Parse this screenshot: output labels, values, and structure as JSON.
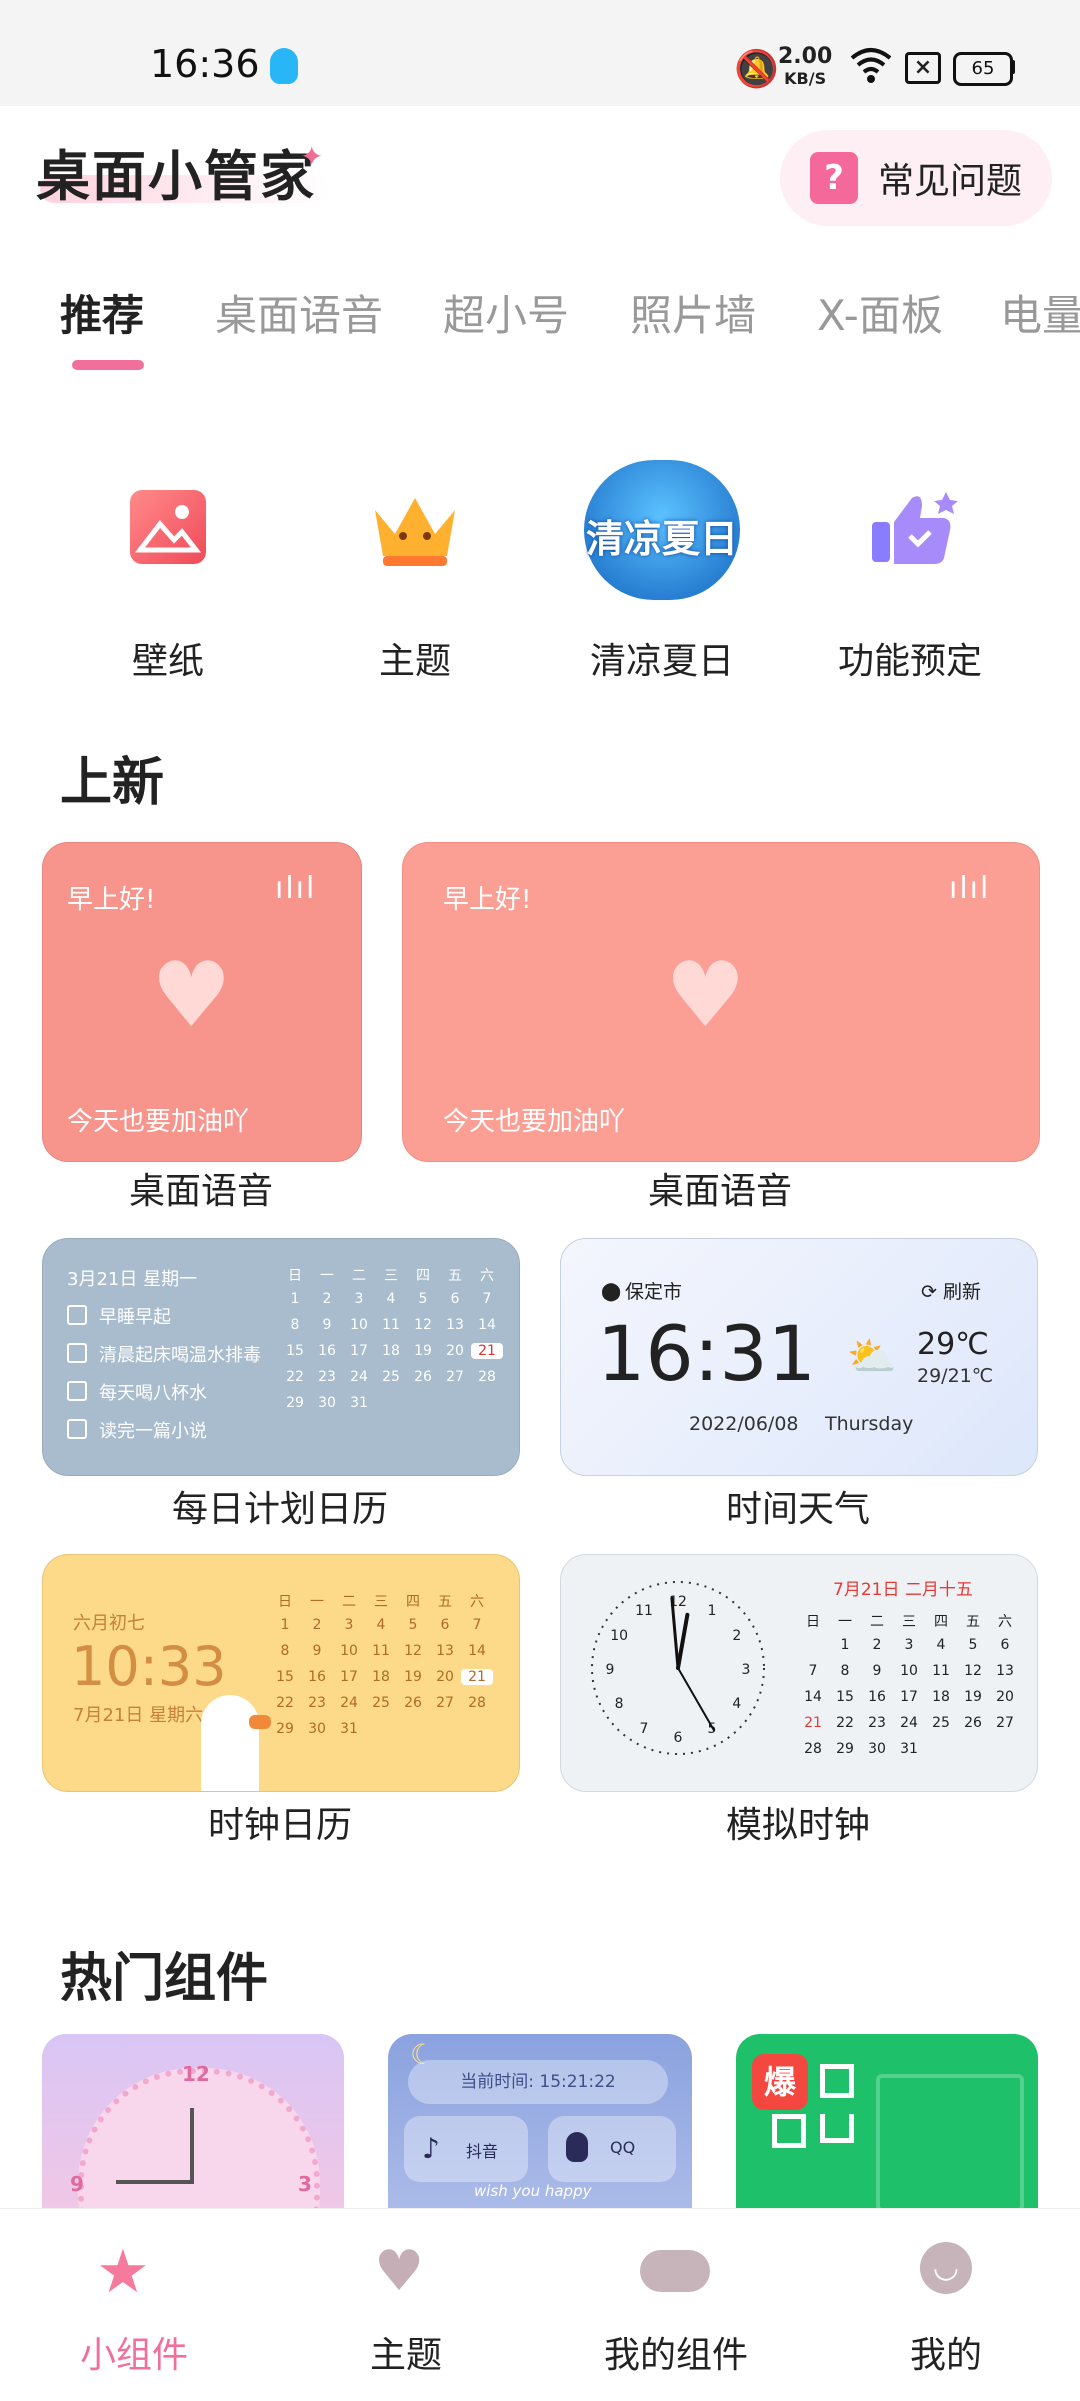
{
  "status": {
    "time": "16:36",
    "speed_value": "2.00",
    "speed_unit": "KB/S",
    "battery": "65"
  },
  "header": {
    "app_title": "桌面小管家",
    "faq_label": "常见问题",
    "faq_icon": "?"
  },
  "tabs": [
    "推荐",
    "桌面语音",
    "超小号",
    "照片墙",
    "X-面板",
    "电量"
  ],
  "quick_entries": [
    {
      "label": "壁纸",
      "icon": "image-icon"
    },
    {
      "label": "主题",
      "icon": "crown-icon"
    },
    {
      "label": "清凉夏日",
      "icon": "summer-badge-icon",
      "badge_text": "清凉夏日"
    },
    {
      "label": "功能预定",
      "icon": "thumbs-up-icon"
    }
  ],
  "sections": {
    "new": "上新",
    "hot": "热门组件"
  },
  "voice_cards": [
    {
      "greeting": "早上好!",
      "message": "今天也要加油吖",
      "caption": "桌面语音"
    },
    {
      "greeting": "早上好!",
      "message": "今天也要加油吖",
      "caption": "桌面语音"
    }
  ],
  "plan_calendar": {
    "caption": "每日计划日历",
    "date": "3月21日 星期一",
    "tasks": [
      "早睡早起",
      "清晨起床喝温水排毒",
      "每天喝八杯水",
      "读完一篇小说"
    ],
    "weekdays": [
      "日",
      "一",
      "二",
      "三",
      "四",
      "五",
      "六"
    ],
    "rows": [
      [
        "1",
        "2",
        "3",
        "4",
        "5",
        "6",
        "7"
      ],
      [
        "8",
        "9",
        "10",
        "11",
        "12",
        "13",
        "14"
      ],
      [
        "15",
        "16",
        "17",
        "18",
        "19",
        "20",
        "21"
      ],
      [
        "22",
        "23",
        "24",
        "25",
        "26",
        "27",
        "28"
      ],
      [
        "29",
        "30",
        "31",
        "",
        "",
        "",
        ""
      ]
    ],
    "highlight": "21"
  },
  "weather": {
    "caption": "时间天气",
    "city": "保定市",
    "refresh": "刷新",
    "time": "16:31",
    "temp": "29℃",
    "range": "29/21℃",
    "date": "2022/06/08",
    "weekday": "Thursday"
  },
  "clock_calendar": {
    "caption": "时钟日历",
    "lunar": "六月初七",
    "time": "10:33",
    "date": "7月21日 星期六",
    "weekdays": [
      "日",
      "一",
      "二",
      "三",
      "四",
      "五",
      "六"
    ],
    "rows": [
      [
        "1",
        "2",
        "3",
        "4",
        "5",
        "6",
        "7"
      ],
      [
        "8",
        "9",
        "10",
        "11",
        "12",
        "13",
        "14"
      ],
      [
        "15",
        "16",
        "17",
        "18",
        "19",
        "20",
        "21"
      ],
      [
        "22",
        "23",
        "24",
        "25",
        "26",
        "27",
        "28"
      ],
      [
        "29",
        "30",
        "31",
        "",
        "",
        "",
        ""
      ]
    ],
    "highlight": "21"
  },
  "analog": {
    "caption": "模拟时钟",
    "header": "7月21日 二月十五",
    "numbers": [
      "12",
      "1",
      "2",
      "3",
      "4",
      "5",
      "6",
      "7",
      "8",
      "9",
      "10",
      "11"
    ],
    "weekdays": [
      "日",
      "一",
      "二",
      "三",
      "四",
      "五",
      "六"
    ],
    "rows": [
      [
        "",
        "1",
        "2",
        "3",
        "4",
        "5",
        "6"
      ],
      [
        "7",
        "8",
        "9",
        "10",
        "11",
        "12",
        "13"
      ],
      [
        "14",
        "15",
        "16",
        "17",
        "18",
        "19",
        "20"
      ],
      [
        "21",
        "22",
        "23",
        "24",
        "25",
        "26",
        "27"
      ],
      [
        "28",
        "29",
        "30",
        "31",
        "",
        "",
        ""
      ]
    ],
    "highlight": "21"
  },
  "hot_items": [
    {
      "clock_numbers": [
        "12",
        "3",
        "9"
      ]
    },
    {
      "time_label": "当前时间: 15:21:22",
      "app1": "抖音",
      "app2": "QQ",
      "wish": "wish you happy"
    },
    {
      "badge": "爆"
    }
  ],
  "bottom_nav": [
    "小组件",
    "主题",
    "我的组件",
    "我的"
  ],
  "colors": {
    "accent": "#f0709b",
    "voice_card": "#f7948c",
    "plan_card": "#a9bccd",
    "weather_card": "#e9effc",
    "clock_card": "#fdd98a",
    "analog_card": "#eef2f5",
    "green": "#1ec06a"
  }
}
